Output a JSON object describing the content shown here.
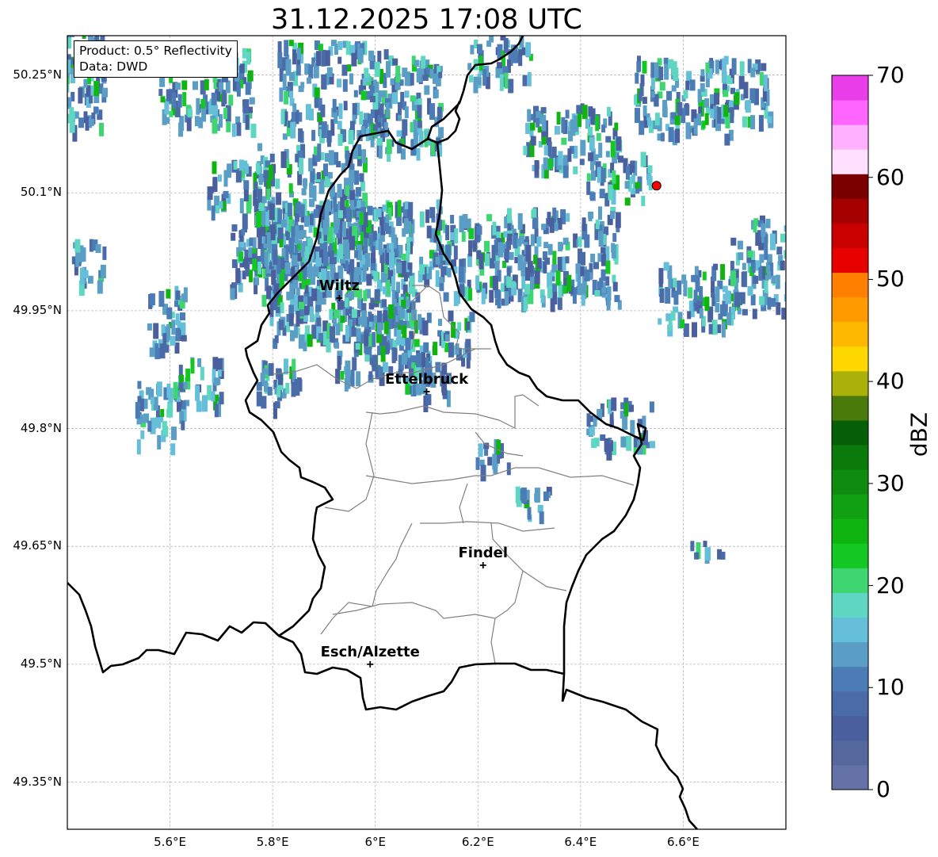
{
  "title": "31.12.2025 17:08 UTC",
  "info_box": {
    "product": "Product: 0.5° Reflectivity",
    "source": "Data: DWD"
  },
  "map": {
    "lon_range": [
      5.4,
      6.8
    ],
    "lat_range": [
      49.29,
      50.3
    ],
    "x_ticks": [
      {
        "lon": 5.6,
        "label": "5.6°E"
      },
      {
        "lon": 5.8,
        "label": "5.8°E"
      },
      {
        "lon": 6.0,
        "label": "6°E"
      },
      {
        "lon": 6.2,
        "label": "6.2°E"
      },
      {
        "lon": 6.4,
        "label": "6.4°E"
      },
      {
        "lon": 6.6,
        "label": "6.6°E"
      }
    ],
    "y_ticks": [
      {
        "lat": 50.25,
        "label": "50.25°N"
      },
      {
        "lat": 50.1,
        "label": "50.1°N"
      },
      {
        "lat": 49.95,
        "label": "49.95°N"
      },
      {
        "lat": 49.8,
        "label": "49.8°N"
      },
      {
        "lat": 49.65,
        "label": "49.65°N"
      },
      {
        "lat": 49.5,
        "label": "49.5°N"
      },
      {
        "lat": 49.35,
        "label": "49.35°N"
      }
    ],
    "cities": [
      {
        "name": "Wiltz",
        "lon": 5.93,
        "lat": 49.966
      },
      {
        "name": "Ettelbruck",
        "lon": 6.1,
        "lat": 49.847
      },
      {
        "name": "Findel",
        "lon": 6.21,
        "lat": 49.626
      },
      {
        "name": "Esch/Alzette",
        "lon": 5.99,
        "lat": 49.5
      }
    ],
    "radar_site": {
      "lon": 6.548,
      "lat": 50.109,
      "color": "#ff0000"
    }
  },
  "colorbar": {
    "label": "dBZ",
    "min": 0,
    "max": 70,
    "ticks": [
      "0",
      "10",
      "20",
      "30",
      "40",
      "50",
      "60",
      "70"
    ],
    "colors": [
      "#6472a8",
      "#54689e",
      "#4a5f9e",
      "#4a6aa8",
      "#4c7cb6",
      "#5a9ec6",
      "#65bfd8",
      "#5ed6c2",
      "#3ed670",
      "#13c822",
      "#10b410",
      "#11a011",
      "#0f8c0f",
      "#0a7a0a",
      "#065e06",
      "#4a7a0a",
      "#aab20a",
      "#ffd700",
      "#ffb800",
      "#ff9a00",
      "#ff7f00",
      "#e60000",
      "#c80000",
      "#a50000",
      "#7a0000",
      "#ffe0ff",
      "#ffb0ff",
      "#ff66ff",
      "#e83de8"
    ]
  }
}
